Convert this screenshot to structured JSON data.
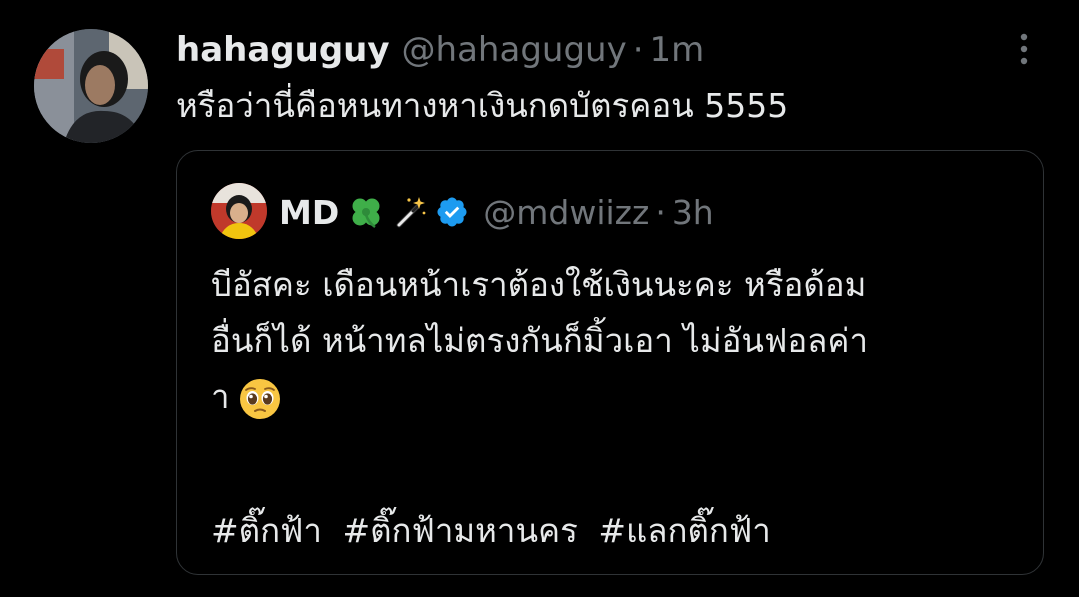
{
  "tweet": {
    "display_name": "hahaguguy",
    "handle": "@hahaguguy",
    "separator": "·",
    "time": "1m",
    "text": "หรือว่านี่คือหนทางหาเงินกดบัตรคอน 5555",
    "more_icon": "more-vertical-icon"
  },
  "quoted_tweet": {
    "display_name": "MD",
    "name_emojis": [
      "four-leaf-clover-icon",
      "magic-wand-icon"
    ],
    "verified_icon": "verified-badge-icon",
    "verified_color": "#1d9bf0",
    "handle": "@mdwiizz",
    "separator": "·",
    "time": "3h",
    "lines": [
      "บีอัสคะ เดือนหน้าเราต้องใช้เงินนะคะ หรือด้อม",
      "อื่นก็ได้ หน้าทลไม่ตรงกันก็มิ้วเอา ไม่อันฟอลค่า",
      "า"
    ],
    "end_emoji": "pleading-face-icon",
    "hashtags": [
      "#ติ๊กฟ้า",
      "#ติ๊กฟ้ามหานคร",
      "#แลกติ๊กฟ้า"
    ]
  },
  "colors": {
    "background": "#000000",
    "primary_text": "#e7e9ea",
    "secondary_text": "#71767b",
    "border": "#2f3336"
  }
}
